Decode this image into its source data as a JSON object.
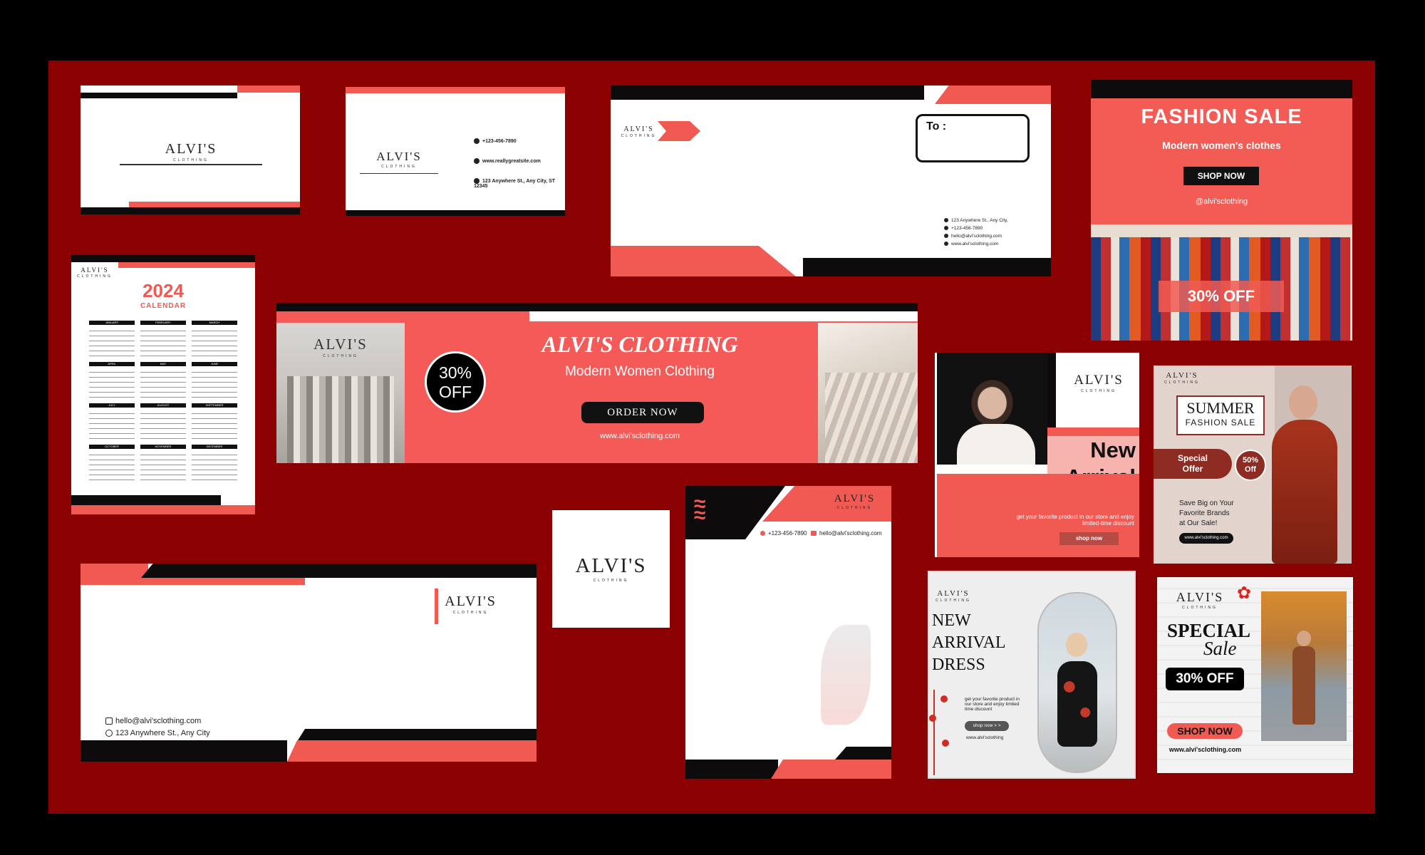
{
  "brand": {
    "name": "ALVI'S",
    "sub": "CLOTHING",
    "accent": "#f05a52",
    "dark": "#0d0b0b",
    "background": "#8b0000"
  },
  "bizcard_back": {
    "phone": "+123-456-7890",
    "web": "www.reallygreatsite.com",
    "address": "123 Anywhere St., Any City, ST 12345"
  },
  "envelope": {
    "to_label": "To :",
    "address": "123 Anywhere St., Any City,",
    "phone": "+123-456-7890",
    "email": "hello@alvi'sclothing.com",
    "web": "www.alvi'sclothing.com"
  },
  "fashion_sale": {
    "title": "FASHION SALE",
    "subtitle": "Modern women's clothes",
    "button": "SHOP NOW",
    "handle": "@alvi'sclothing",
    "offer": "30% OFF"
  },
  "calendar": {
    "year": "2024",
    "label": "CALENDAR",
    "months": [
      "JANUARY",
      "FEBRUARY",
      "MARCH",
      "APRIL",
      "MAY",
      "JUNE",
      "JULY",
      "AUGUST",
      "SEPTEMBER",
      "OCTOBER",
      "NOVEMBER",
      "DECEMBER"
    ]
  },
  "banner": {
    "badge_pct": "30%",
    "badge_off": "OFF",
    "title": "ALVI'S CLOTHING",
    "subtitle": "Modern Women Clothing",
    "button": "ORDER NOW",
    "url": "www.alvi'sclothing.com"
  },
  "new_arrival_post": {
    "title_line1": "New",
    "title_line2": "Arrival",
    "desc": "get your favorite product in our store and enjoy limited-time discount",
    "button": "shop now"
  },
  "summer_post": {
    "title": "SUMMER",
    "subtitle": "FASHION SALE",
    "special": "Special",
    "offer": "Offer",
    "pct": "50%",
    "off": "Off",
    "desc_1": "Save Big on Your",
    "desc_2": "Favorite Brands",
    "desc_3": "at Our Sale!",
    "url": "www.alvi'sclothing.com"
  },
  "letterhead_contact": {
    "email": "hello@alvi'sclothing.com",
    "address": "123 Anywhere St., Any City"
  },
  "letterhead2": {
    "phone": "+123-456-7890",
    "email": "hello@alvi'sclothing.com"
  },
  "dress_post": {
    "line1": "NEW",
    "line2": "ARRIVAL",
    "line3": "DRESS",
    "desc": "get your favorite product in our store and enjoy limited time discount",
    "button": "shop now > >",
    "url": "www.alvi'sclothing"
  },
  "special_post": {
    "title": "SPECIAL",
    "script": "Sale",
    "offer": "30% OFF",
    "button": "SHOP NOW",
    "url": "www.alvi'sclothing.com"
  }
}
